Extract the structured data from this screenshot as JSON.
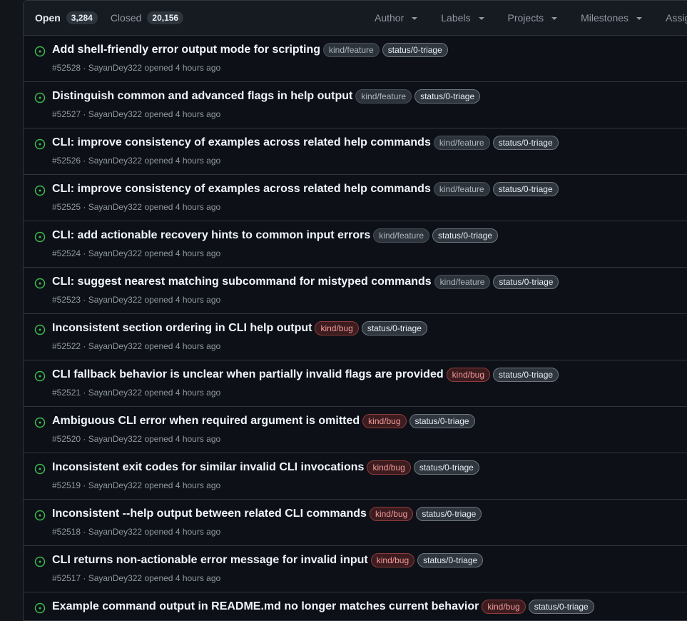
{
  "header": {
    "open_label": "Open",
    "open_count": "3,284",
    "closed_label": "Closed",
    "closed_count": "20,156",
    "filters": [
      "Author",
      "Labels",
      "Projects",
      "Milestones",
      "Assignees"
    ]
  },
  "issues": [
    {
      "title": "Add shell-friendly error output mode for scripting",
      "labels": [
        "kind/feature",
        "status/0-triage"
      ],
      "number": "#52528",
      "meta": "SayanDey322 opened 4 hours ago"
    },
    {
      "title": "Distinguish common and advanced flags in help output",
      "labels": [
        "kind/feature",
        "status/0-triage"
      ],
      "number": "#52527",
      "meta": "SayanDey322 opened 4 hours ago"
    },
    {
      "title": "CLI: improve consistency of examples across related help commands",
      "labels": [
        "kind/feature",
        "status/0-triage"
      ],
      "number": "#52526",
      "meta": "SayanDey322 opened 4 hours ago"
    },
    {
      "title": "CLI: improve consistency of examples across related help commands",
      "labels": [
        "kind/feature",
        "status/0-triage"
      ],
      "number": "#52525",
      "meta": "SayanDey322 opened 4 hours ago"
    },
    {
      "title": "CLI: add actionable recovery hints to common input errors",
      "labels": [
        "kind/feature",
        "status/0-triage"
      ],
      "number": "#52524",
      "meta": "SayanDey322 opened 4 hours ago"
    },
    {
      "title": "CLI: suggest nearest matching subcommand for mistyped commands",
      "labels": [
        "kind/feature",
        "status/0-triage"
      ],
      "number": "#52523",
      "meta": "SayanDey322 opened 4 hours ago"
    },
    {
      "title": "Inconsistent section ordering in CLI help output",
      "labels": [
        "kind/bug",
        "status/0-triage"
      ],
      "number": "#52522",
      "meta": "SayanDey322 opened 4 hours ago"
    },
    {
      "title": "CLI fallback behavior is unclear when partially invalid flags are provided",
      "labels": [
        "kind/bug",
        "status/0-triage"
      ],
      "number": "#52521",
      "meta": "SayanDey322 opened 4 hours ago"
    },
    {
      "title": "Ambiguous CLI error when required argument is omitted",
      "labels": [
        "kind/bug",
        "status/0-triage"
      ],
      "number": "#52520",
      "meta": "SayanDey322 opened 4 hours ago"
    },
    {
      "title": "Inconsistent exit codes for similar invalid CLI invocations",
      "labels": [
        "kind/bug",
        "status/0-triage"
      ],
      "number": "#52519",
      "meta": "SayanDey322 opened 4 hours ago"
    },
    {
      "title": "Inconsistent --help output between related CLI commands",
      "labels": [
        "kind/bug",
        "status/0-triage"
      ],
      "number": "#52518",
      "meta": "SayanDey322 opened 4 hours ago"
    },
    {
      "title": "CLI returns non-actionable error message for invalid input",
      "labels": [
        "kind/bug",
        "status/0-triage"
      ],
      "number": "#52517",
      "meta": "SayanDey322 opened 4 hours ago"
    },
    {
      "title": "Example command output in README.md no longer matches current behavior",
      "labels": [
        "kind/bug",
        "status/0-triage"
      ],
      "number": "",
      "meta": ""
    }
  ],
  "colors": {
    "open_icon": "#3fb950",
    "bug_label": "#f29999",
    "feature_label": "#adb5bd"
  },
  "icons": {
    "issue_status": "issue-opened-icon",
    "filter_caret": "chevron-down-icon"
  }
}
